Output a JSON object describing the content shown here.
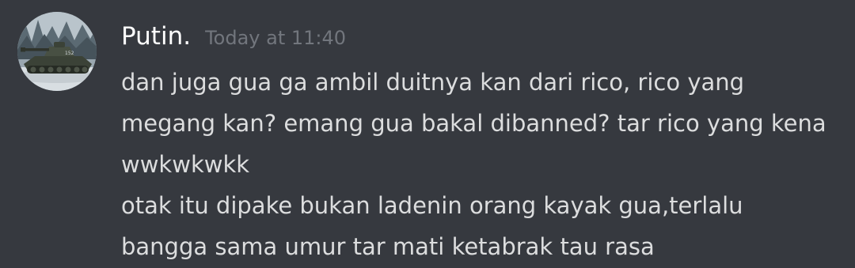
{
  "message": {
    "author": "Putin.",
    "timestamp": "Today at 11:40",
    "avatar_icon": "tank-avatar-icon",
    "lines": [
      "dan juga gua ga ambil duitnya kan dari rico, rico yang",
      "megang kan? emang gua bakal dibanned? tar rico yang kena",
      "wwkwkwkk",
      "otak itu dipake bukan ladenin orang kayak gua,terlalu",
      "bangga sama umur tar mati ketabrak tau rasa"
    ]
  },
  "colors": {
    "background": "#36393f",
    "username": "#ffffff",
    "timestamp": "#72767d",
    "message_text": "#dcddde"
  }
}
